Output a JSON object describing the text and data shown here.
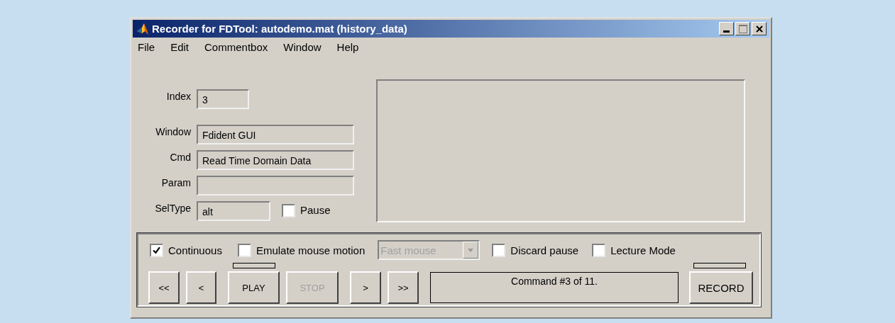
{
  "window": {
    "title": "Recorder for FDTool: autodemo.mat (history_data)"
  },
  "menu": [
    "File",
    "Edit",
    "Commentbox",
    "Window",
    "Help"
  ],
  "fields": [
    {
      "label": "Index",
      "value": "3"
    },
    {
      "label": "Window",
      "value": "Fdident GUI"
    },
    {
      "label": "Cmd",
      "value": "Read Time Domain Data"
    },
    {
      "label": "Param"
    },
    {
      "label": "SelType",
      "value": "alt"
    }
  ],
  "pause": {
    "label": "Pause",
    "checked": false
  },
  "options": [
    {
      "kind": "checkbox",
      "label": "Continuous",
      "checked": true
    },
    {
      "kind": "checkbox",
      "label": "Emulate mouse motion",
      "checked": false
    },
    {
      "kind": "dropdown",
      "value": "Fast mouse",
      "disabled": true
    },
    {
      "kind": "checkbox",
      "label": "Discard pause",
      "checked": false
    },
    {
      "kind": "checkbox",
      "label": "Lecture Mode",
      "checked": false
    }
  ],
  "buttons": [
    {
      "label": "<<",
      "disabled": false
    },
    {
      "label": "<",
      "disabled": false
    },
    {
      "label": "PLAY",
      "disabled": false
    },
    {
      "label": "STOP",
      "disabled": true
    },
    {
      "label": ">",
      "disabled": false
    },
    {
      "label": ">>",
      "disabled": false
    }
  ],
  "status": "Command #3 of 11.",
  "record_button": {
    "label": "RECORD",
    "disabled": false
  }
}
